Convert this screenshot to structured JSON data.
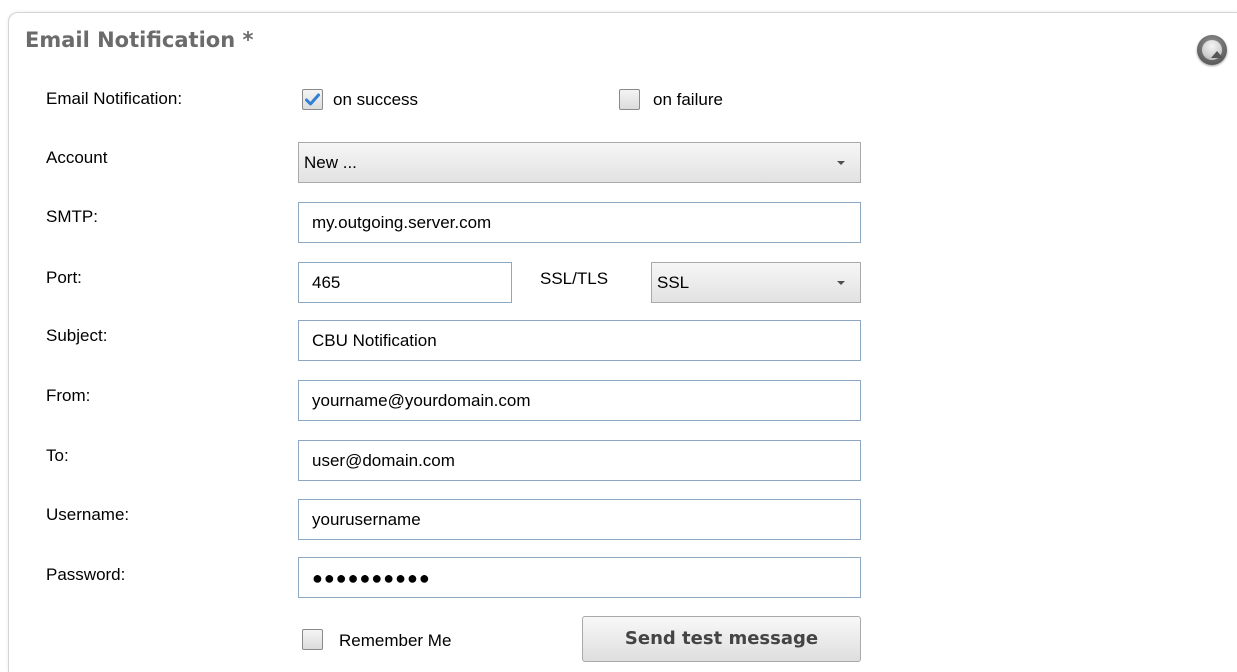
{
  "panel": {
    "title": "Email Notification *"
  },
  "notification": {
    "label": "Email Notification:",
    "on_success": {
      "label": "on success",
      "checked": true
    },
    "on_failure": {
      "label": "on failure",
      "checked": false
    }
  },
  "account": {
    "label": "Account",
    "selected": "New ..."
  },
  "smtp": {
    "label": "SMTP:",
    "value": "my.outgoing.server.com"
  },
  "port": {
    "label": "Port:",
    "value": "465"
  },
  "ssl": {
    "label": "SSL/TLS",
    "selected": "SSL"
  },
  "subject": {
    "label": "Subject:",
    "value": "CBU Notification"
  },
  "from": {
    "label": "From:",
    "value": "yourname@yourdomain.com"
  },
  "to": {
    "label": "To:",
    "value": "user@domain.com"
  },
  "username": {
    "label": "Username:",
    "value": "yourusername"
  },
  "password": {
    "label": "Password:",
    "value": "●●●●●●●●●●"
  },
  "remember": {
    "label": "Remember Me",
    "checked": false
  },
  "test_button": {
    "label": "Send test message"
  },
  "icons": {
    "collapse": "chevron-up-icon",
    "check": "check-icon",
    "dropdown": "caret-down-icon"
  },
  "colors": {
    "title": "#6b6b6b",
    "input_border": "#8ea7c2",
    "check": "#2f7fd6"
  }
}
